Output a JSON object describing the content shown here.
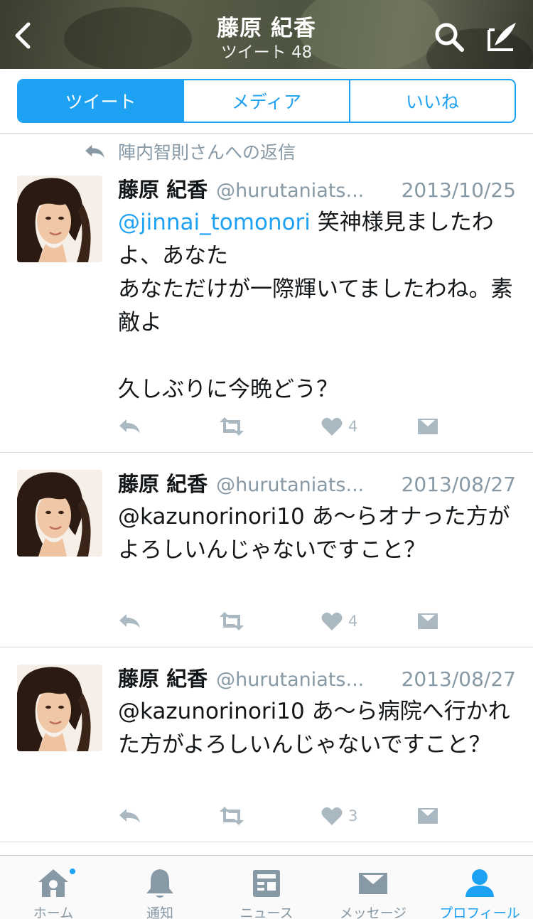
{
  "header": {
    "title": "藤原 紀香",
    "subtitle": "ツイート 48"
  },
  "segments": [
    {
      "label": "ツイート",
      "active": true
    },
    {
      "label": "メディア",
      "active": false
    },
    {
      "label": "いいね",
      "active": false
    }
  ],
  "reply_context": "陣内智則さんへの返信",
  "tweets": [
    {
      "name": "藤原 紀香",
      "handle": "@hurutaniats...",
      "date": "2013/10/25",
      "mention": "@jinnai_tomonori",
      "text": " 笑神様見ましたわよ、あなた\nあなただけが一際輝いてましたわね。素敵よ\n\n久しぶりに今晩どう？",
      "likes": "4"
    },
    {
      "name": "藤原 紀香",
      "handle": "@hurutaniats...",
      "date": "2013/08/27",
      "text": "@kazunorinori10 あ〜らオナった方がよろしいんじゃないですこと？",
      "likes": "4"
    },
    {
      "name": "藤原 紀香",
      "handle": "@hurutaniats...",
      "date": "2013/08/27",
      "text": "@kazunorinori10 あ〜ら病院へ行かれた方がよろしいんじゃないですこと？",
      "likes": "3"
    }
  ],
  "tabbar": [
    {
      "label": "ホーム",
      "icon": "home-icon",
      "active": false,
      "badge": true
    },
    {
      "label": "通知",
      "icon": "bell-icon",
      "active": false
    },
    {
      "label": "ニュース",
      "icon": "news-icon",
      "active": false
    },
    {
      "label": "メッセージ",
      "icon": "envelope-icon",
      "active": false
    },
    {
      "label": "プロフィール",
      "icon": "person-icon",
      "active": true
    }
  ],
  "colors": {
    "accent": "#1da1f2",
    "muted": "#8899a6",
    "action_gray": "#aab8c2"
  }
}
